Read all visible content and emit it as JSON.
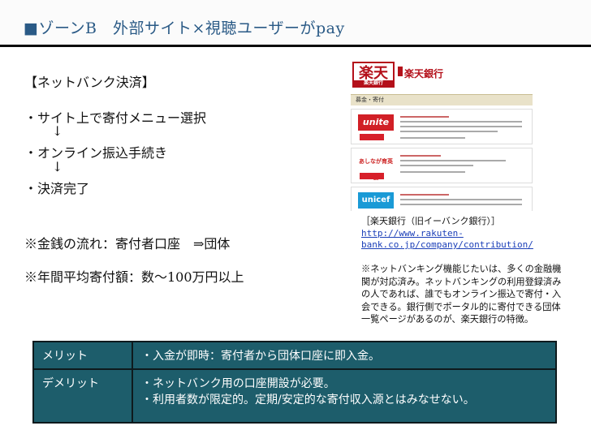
{
  "title": "■ゾーンB　外部サイト×視聴ユーザーがpay",
  "section_heading": "【ネットバンク決済】",
  "steps": [
    "・サイト上で寄付メニュー選択",
    "・オンライン振込手続き",
    "・決済完了"
  ],
  "arrow": "↓",
  "money_flow": "※金銭の流れ：寄付者口座　⇒団体",
  "annual_amount": "※年間平均寄付額：数～100万円以上",
  "screenshot": {
    "logo_text": "楽天",
    "logo_sub": "楽天銀行",
    "bank_name": "楽天銀行",
    "tab_label": "募金・寄付",
    "cards": [
      "unite",
      "あしなが育英会",
      "unicef"
    ]
  },
  "caption_source": "［楽天銀行（旧イーバンク銀行）］",
  "caption_url_1": "http://www.rakuten-",
  "caption_url_2": "bank.co.jp/company/contribution/",
  "note": "※ネットバンキング機能じたいは、多くの金融機関が対応済み。ネットバンキングの利用登録済みの人であれば、誰でもオンライン振込で寄付・入会できる。銀行側でポータル的に寄付できる団体一覧ページがあるのが、楽天銀行の特徴。",
  "table": {
    "merit_label": "メリット",
    "merit_text": "・入金が即時：寄付者から団体口座に即入金。",
    "demerit_label": "デメリット",
    "demerit_text_1": "・ネットバンク用の口座開設が必要。",
    "demerit_text_2": "・利用者数が限定的。定期/安定的な寄付収入源とはみなせない。"
  },
  "colors": {
    "title_blue": "#2a5a86",
    "table_teal": "#1d5d6b",
    "rakuten_red": "#b4101a",
    "link_blue": "#1b3fb8"
  }
}
